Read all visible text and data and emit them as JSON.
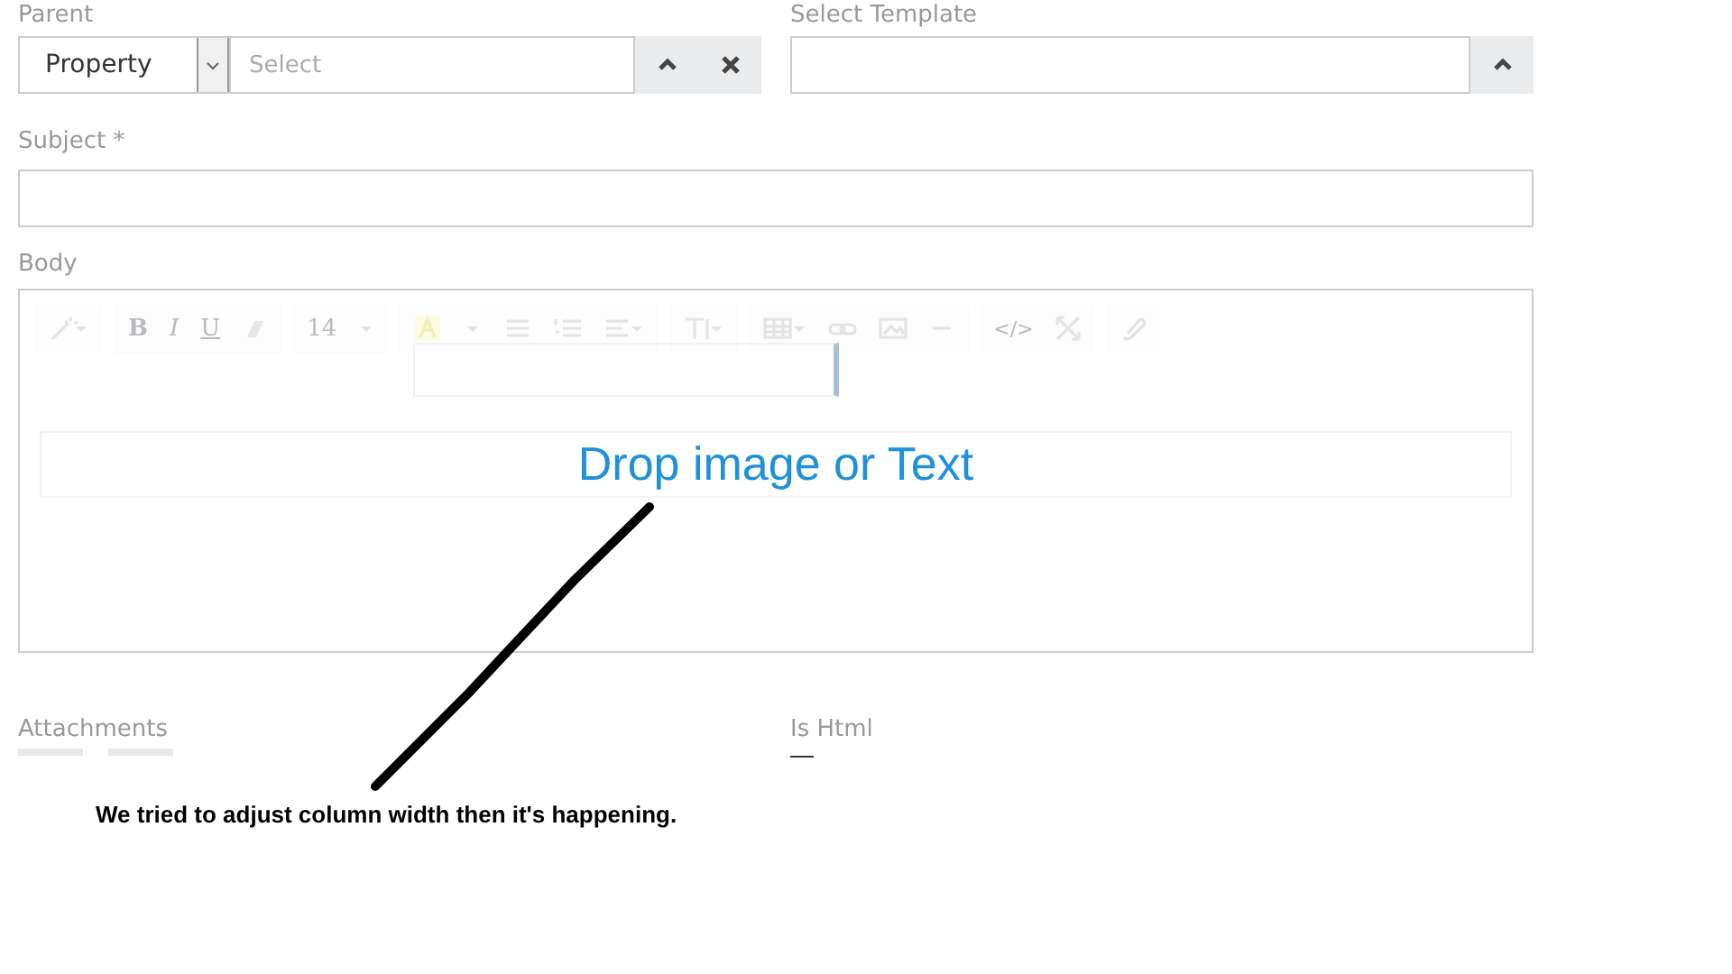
{
  "parent": {
    "label": "Parent",
    "type_select": {
      "value": "Property"
    },
    "search": {
      "placeholder": "Select"
    }
  },
  "template": {
    "label": "Select Template"
  },
  "subject": {
    "label": "Subject *"
  },
  "body": {
    "label": "Body",
    "toolbar_labels": [
      "B",
      "I",
      "U",
      "14",
      "</>"
    ],
    "drop_zone": "Drop image or Text"
  },
  "attachments": {
    "label": "Attachments"
  },
  "is_html": {
    "label": "Is Html"
  },
  "annotation": "We tried to adjust column width then it's happening."
}
